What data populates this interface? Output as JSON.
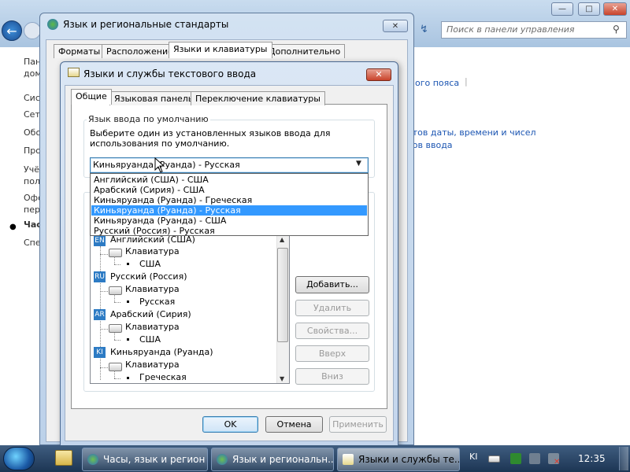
{
  "control_panel": {
    "search_placeholder": "Поиск в панели управления",
    "left_items": [
      "Пан",
      "дом",
      "Сис",
      "Сет",
      "Обо",
      "Про",
      "Учё",
      "пол",
      "Офо",
      "пер",
      "Час",
      "Спе"
    ],
    "links": [
      "ого пояса",
      "атов даты, времени и чисел",
      "бов ввода"
    ],
    "min_label": "—",
    "max_label": "□",
    "close_label": "✕"
  },
  "regional_window": {
    "title": "Язык и региональные стандарты",
    "close_label": "✕",
    "tabs": [
      "Форматы",
      "Расположение",
      "Языки и клавиатуры",
      "Дополнительно"
    ],
    "selected_tab": 2
  },
  "dialog": {
    "title": "Языки и службы текстового ввода",
    "close_label": "✕",
    "tabs": [
      "Общие",
      "Языковая панель",
      "Переключение клавиатуры"
    ],
    "selected_tab": 0,
    "group_label": "Язык ввода по умолчанию",
    "group_description": "Выберите один из установленных языков ввода для использования по умолчанию.",
    "combo_value": "Киньяруанда (Руанда) - Русская",
    "dropdown_options": [
      "Английский (США) - США",
      "Арабский (Сирия) - США",
      "Киньяруанда (Руанда) - Греческая",
      "Киньяруанда (Руанда) - Русская",
      "Киньяруанда (Руанда) - США",
      "Русский (Россия) - Русская"
    ],
    "dropdown_selected": 3,
    "tree": [
      {
        "badge": "EN",
        "lang": "Английский (США)",
        "category": "Клавиатура",
        "layout": "США"
      },
      {
        "badge": "RU",
        "lang": "Русский (Россия)",
        "category": "Клавиатура",
        "layout": "Русская"
      },
      {
        "badge": "AR",
        "lang": "Арабский (Сирия)",
        "category": "Клавиатура",
        "layout": "США"
      },
      {
        "badge": "KI",
        "lang": "Киньяруанда (Руанда)",
        "category": "Клавиатура",
        "layout": "Греческая"
      }
    ],
    "side_buttons": {
      "add": "Добавить...",
      "remove": "Удалить",
      "properties": "Свойства...",
      "up": "Вверх",
      "down": "Вниз"
    },
    "ok": "OK",
    "cancel": "Отмена",
    "apply": "Применить"
  },
  "taskbar": {
    "tasks": [
      "Часы, язык и регион",
      "Язык и региональн...",
      "Языки и службы те..."
    ],
    "active_task": 2,
    "tray_lang": "KI",
    "clock": "12:35"
  },
  "colors": {
    "selection": "#3399ff",
    "lang_badge": "#2d7bc4",
    "taskbar": "#1c3553"
  }
}
